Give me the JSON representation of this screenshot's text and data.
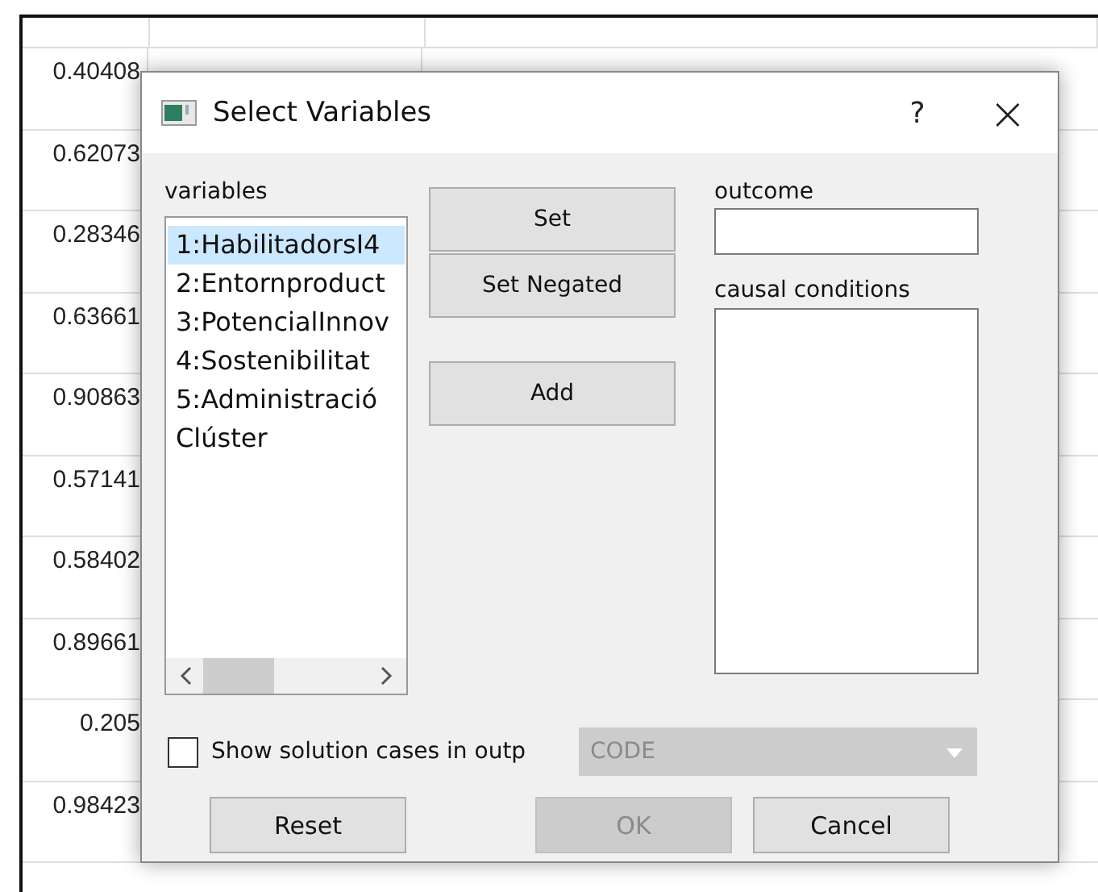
{
  "sheet": {
    "rows": [
      {
        "column_1": "0.40408"
      },
      {
        "column_1": "0.62073"
      },
      {
        "column_1": "0.28346"
      },
      {
        "column_1": "0.63661"
      },
      {
        "column_1": "0.90863"
      },
      {
        "column_1": "0.57141"
      },
      {
        "column_1": "0.58402"
      },
      {
        "column_1": "0.89661"
      },
      {
        "column_1": "0.205"
      },
      {
        "column_1": "0.98423"
      }
    ]
  },
  "dialog": {
    "title": "Select Variables",
    "help": "?",
    "close": "×",
    "variables_label": "variables",
    "variables": [
      {
        "label": "1:HabilitadorsI4",
        "selected": true
      },
      {
        "label": "2:Entornproduct",
        "selected": false
      },
      {
        "label": "3:PotencialInnov",
        "selected": false
      },
      {
        "label": "4:Sostenibilitat",
        "selected": false
      },
      {
        "label": "5:Administració",
        "selected": false
      },
      {
        "label": "Clúster",
        "selected": false
      }
    ],
    "middle_buttons": [
      {
        "label": "Set"
      },
      {
        "label": "Set Negated"
      },
      {
        "label": "Add"
      }
    ],
    "outcome_label": "outcome",
    "causal_conditions_label": "causal conditions",
    "show_cases": {
      "label": "Show solution cases in outp",
      "checked": false
    },
    "output_combo": {
      "value": "CODE",
      "disabled": true
    },
    "buttons": [
      {
        "label": "Reset",
        "disabled": false
      },
      {
        "label": "OK",
        "disabled": true
      },
      {
        "label": "Cancel",
        "disabled": false
      }
    ]
  }
}
